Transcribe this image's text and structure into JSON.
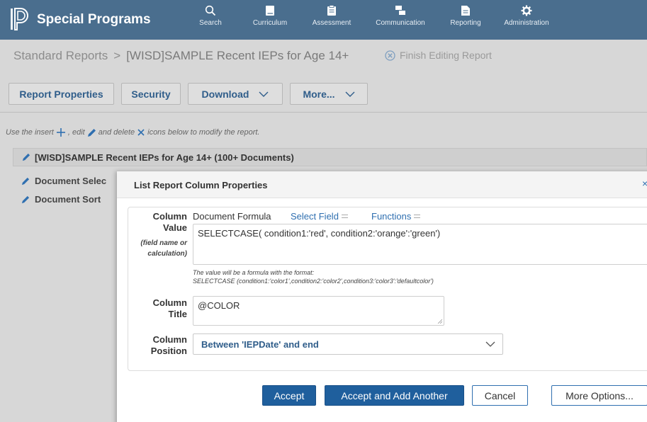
{
  "app": {
    "title": "Special Programs"
  },
  "nav": {
    "items": [
      {
        "label": "Search",
        "icon": "search-icon"
      },
      {
        "label": "Curriculum",
        "icon": "book-icon"
      },
      {
        "label": "Assessment",
        "icon": "clipboard-icon"
      },
      {
        "label": "Communication",
        "icon": "chat-icon"
      },
      {
        "label": "Reporting",
        "icon": "report-icon"
      },
      {
        "label": "Administration",
        "icon": "gear-icon"
      }
    ]
  },
  "breadcrumb": {
    "parent": "Standard Reports",
    "separator": ">",
    "current": "[WISD]SAMPLE Recent IEPs for Age 14+"
  },
  "finish_editing": "Finish Editing Report",
  "toolbar": {
    "report_properties": "Report Properties",
    "security": "Security",
    "download": "Download",
    "more": "More..."
  },
  "hint": {
    "p1": "Use the insert",
    "p2": ", edit",
    "p3": "and delete",
    "p4": "icons below to modify the report."
  },
  "report": {
    "title": "[WISD]SAMPLE Recent IEPs for Age 14+ (100+ Documents)"
  },
  "side_items": [
    "Document Selec",
    "Document Sort"
  ],
  "dialog": {
    "title": "List Report Column Properties",
    "close": "×",
    "value_label_1": "Column",
    "value_label_2": "Value",
    "value_sub_1": "(field name or",
    "value_sub_2": "calculation)",
    "document_formula": "Document Formula",
    "select_field": "Select Field",
    "functions": "Functions",
    "value_text": "SELECTCASE( condition1:'red', condition2:'orange':'green')",
    "help_1": "The value will be a formula with the format:",
    "help_2": "SELECTCASE (condition1:'color1',condition2:'color2',condition3:'color3':'defaultcolor')",
    "title_label_1": "Column",
    "title_label_2": "Title",
    "title_text": "@COLOR",
    "position_label_1": "Column",
    "position_label_2": "Position",
    "position_value": "Between 'IEPDate' and end",
    "buttons": {
      "accept": "Accept",
      "accept_add": "Accept and Add Another",
      "cancel": "Cancel",
      "more_options": "More Options..."
    }
  },
  "colors": {
    "nav_bg": "#4a6e8e",
    "primary": "#1f5f9d",
    "link": "#2f6fb0",
    "bold_link": "#2f5d8a"
  }
}
